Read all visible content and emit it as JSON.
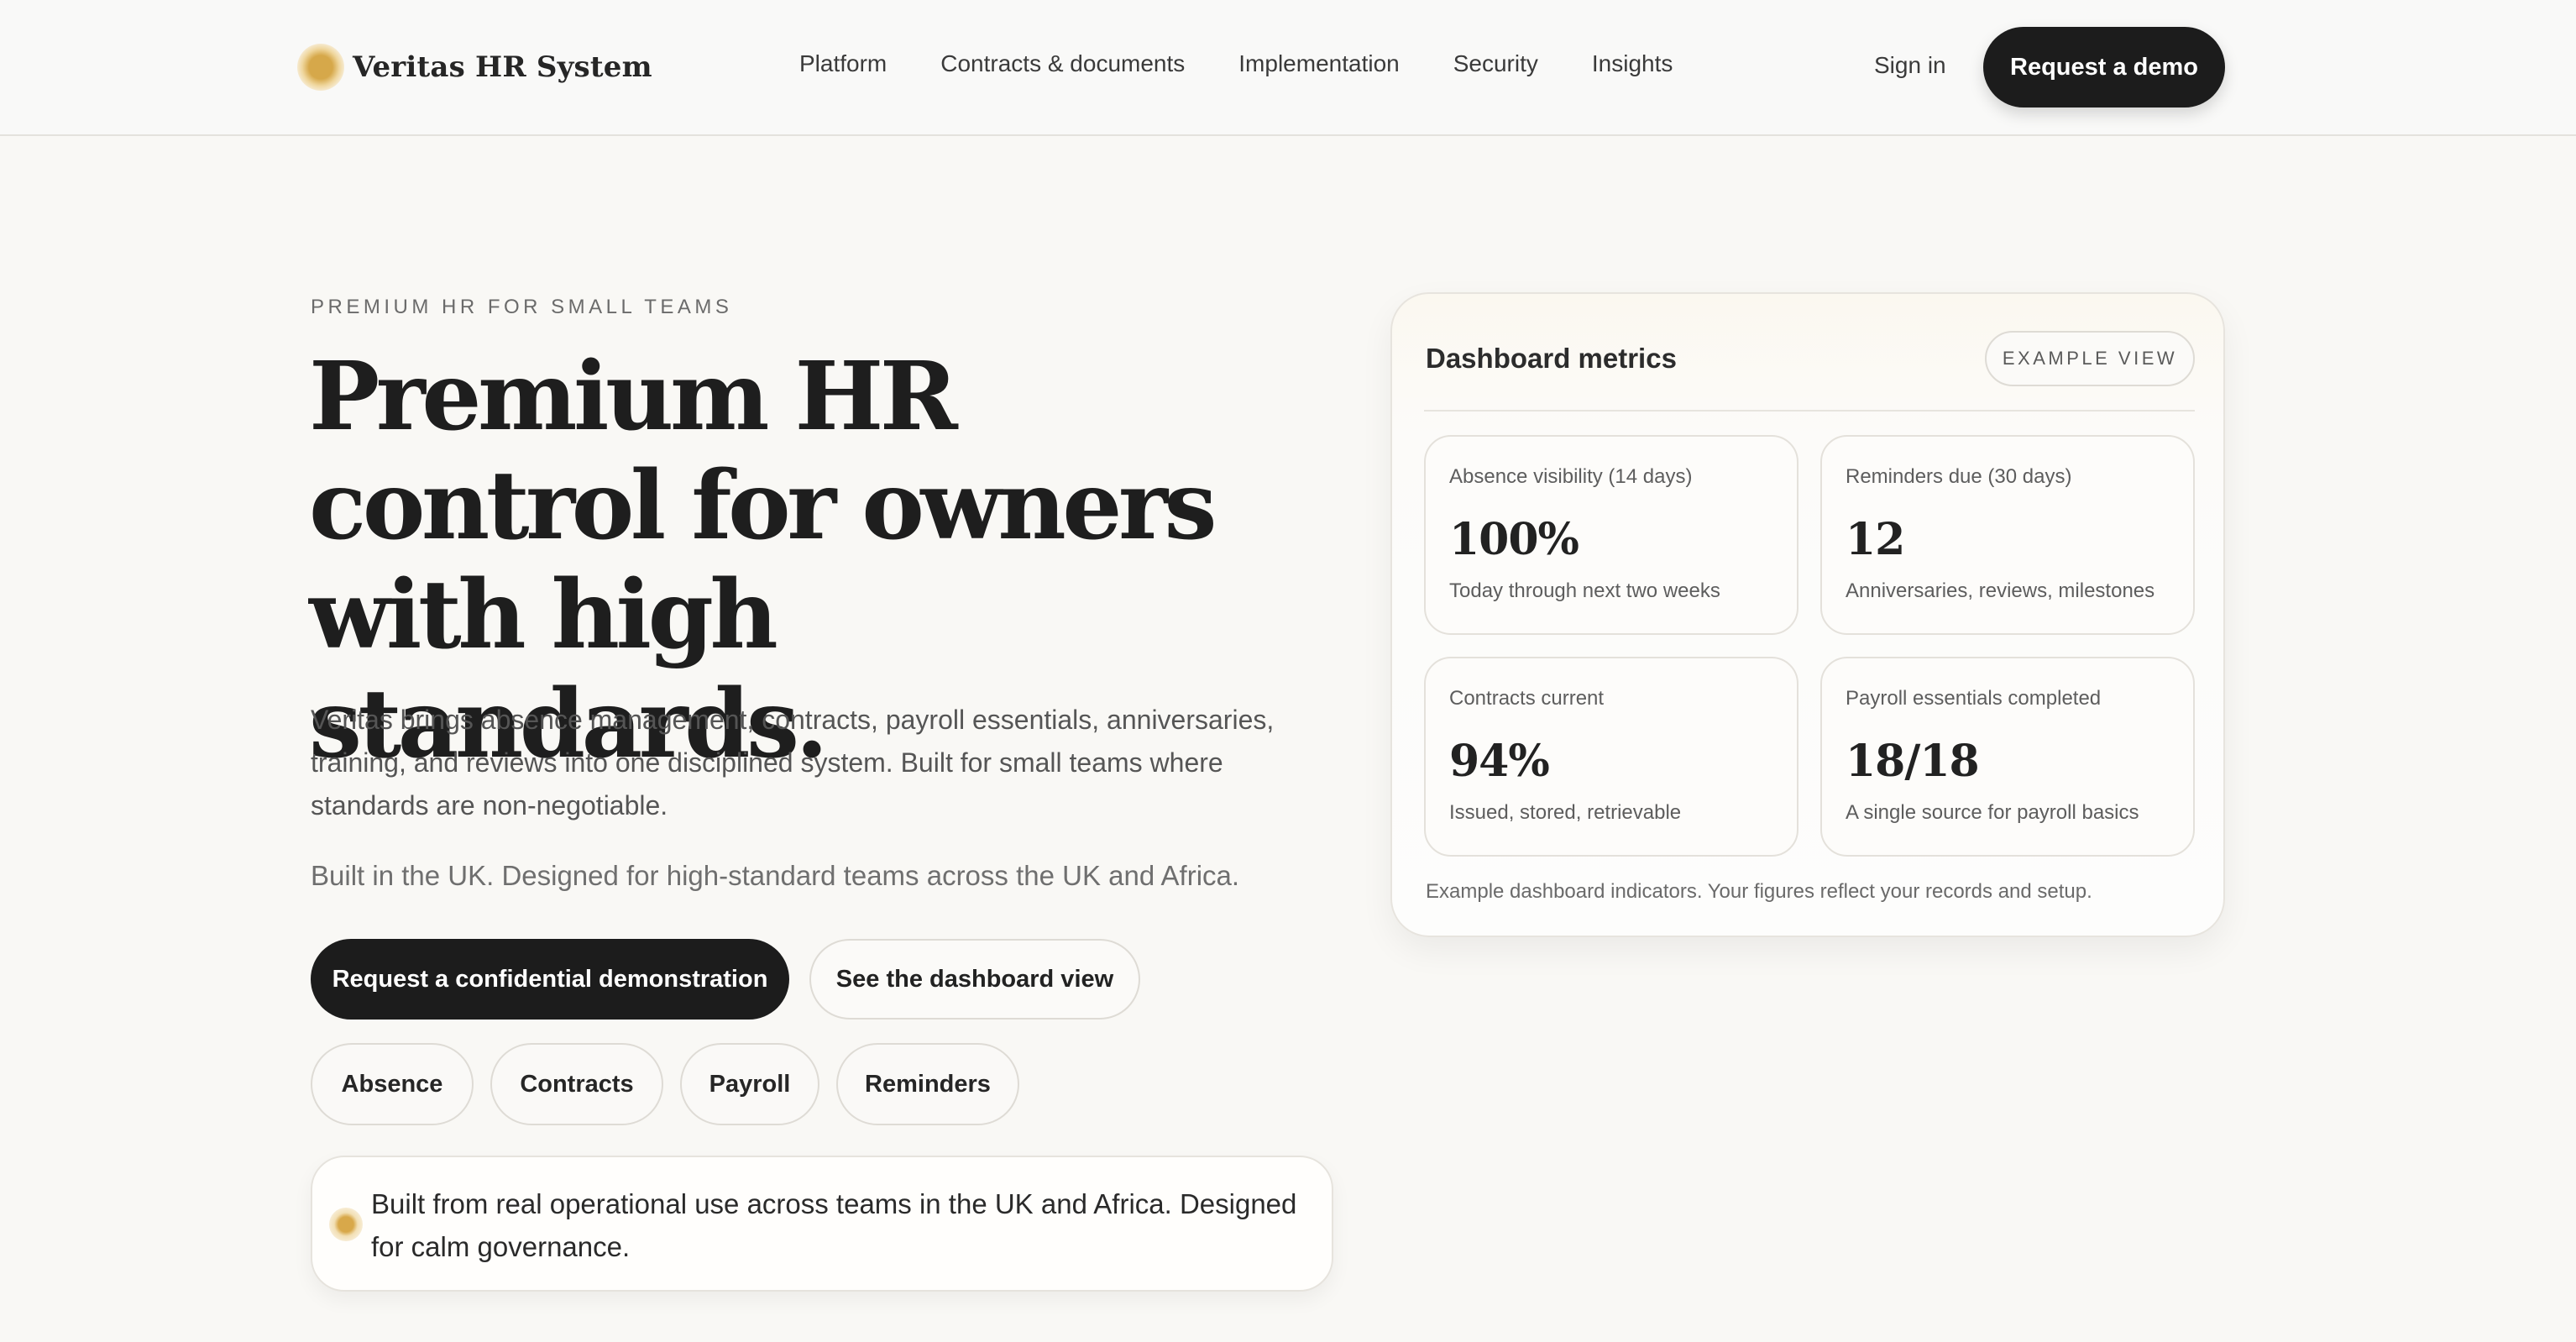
{
  "header": {
    "brand_name": "Veritas HR System",
    "nav": [
      "Platform",
      "Contracts & documents",
      "Implementation",
      "Security",
      "Insights"
    ],
    "sign_in": "Sign in",
    "cta": "Request a demo"
  },
  "hero": {
    "eyebrow": "PREMIUM HR FOR SMALL TEAMS",
    "headline": "Premium HR control for owners with high standards.",
    "lede": "Veritas brings absence management, contracts, payroll essentials, anniversaries, training, and reviews into one disciplined system. Built for small teams where standards are non-negotiable.",
    "sub": "Built in the UK. Designed for high-standard teams across the UK and Africa.",
    "primary_button": "Request a confidential demonstration",
    "secondary_button": "See the dashboard view",
    "chips": [
      "Absence",
      "Contracts",
      "Payroll",
      "Reminders"
    ],
    "note": "Built from real operational use across teams in the UK and Africa. Designed for calm governance."
  },
  "dashboard": {
    "title": "Dashboard metrics",
    "badge": "EXAMPLE VIEW",
    "metrics": [
      {
        "label": "Absence visibility (14 days)",
        "value": "100%",
        "sub": "Today through next two weeks"
      },
      {
        "label": "Reminders due (30 days)",
        "value": "12",
        "sub": "Anniversaries, reviews, milestones"
      },
      {
        "label": "Contracts current",
        "value": "94%",
        "sub": "Issued, stored, retrievable"
      },
      {
        "label": "Payroll essentials completed",
        "value": "18/18",
        "sub": "A single source for payroll basics"
      }
    ],
    "footnote": "Example dashboard indicators. Your figures reflect your records and setup."
  },
  "colors": {
    "accent_gold": "#d6a84a",
    "dark_button": "#1c1c1c",
    "background": "#f9f8f5"
  }
}
